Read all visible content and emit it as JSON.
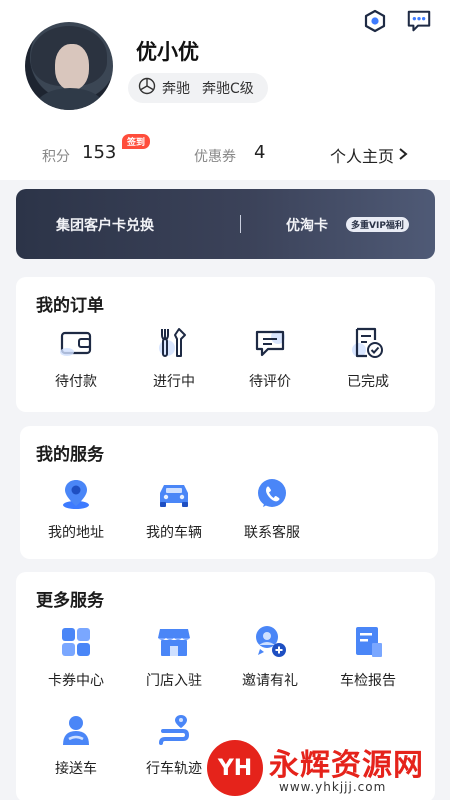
{
  "profile": {
    "name": "优小优",
    "car_brand": "奔驰",
    "car_model": "奔驰C级"
  },
  "stats": {
    "points_label": "积分",
    "points_value": "153",
    "signin_badge": "签到",
    "coupons_label": "优惠券",
    "coupons_value": "4",
    "homepage_link": "个人主页"
  },
  "vip_banner": {
    "left_text": "集团客户卡兑换",
    "right_text": "优淘卡",
    "tag": "多重VIP福利"
  },
  "orders": {
    "title": "我的订单",
    "items": [
      {
        "label": "待付款",
        "icon": "wallet-icon"
      },
      {
        "label": "进行中",
        "icon": "tools-icon"
      },
      {
        "label": "待评价",
        "icon": "comment-icon"
      },
      {
        "label": "已完成",
        "icon": "completed-doc-icon"
      }
    ]
  },
  "services": {
    "title": "我的服务",
    "items": [
      {
        "label": "我的地址",
        "icon": "location-pin-icon"
      },
      {
        "label": "我的车辆",
        "icon": "car-icon"
      },
      {
        "label": "联系客服",
        "icon": "phone-icon"
      }
    ]
  },
  "more": {
    "title": "更多服务",
    "items": [
      {
        "label": "卡券中心",
        "icon": "card-grid-icon"
      },
      {
        "label": "门店入驻",
        "icon": "store-icon"
      },
      {
        "label": "邀请有礼",
        "icon": "invite-user-icon"
      },
      {
        "label": "车检报告",
        "icon": "report-icon"
      },
      {
        "label": "接送车",
        "icon": "driver-icon"
      },
      {
        "label": "行车轨迹",
        "icon": "route-icon"
      }
    ]
  },
  "watermark": {
    "logo_text": "YH",
    "title": "永辉资源网",
    "url": "www.yhkjjj.com"
  },
  "colors": {
    "accent_blue": "#3d7bff",
    "icon_blue": "#4a86f7",
    "badge_red": "#ff4d3b",
    "banner_dark": "#2c3448",
    "watermark_red": "#e5231b"
  }
}
